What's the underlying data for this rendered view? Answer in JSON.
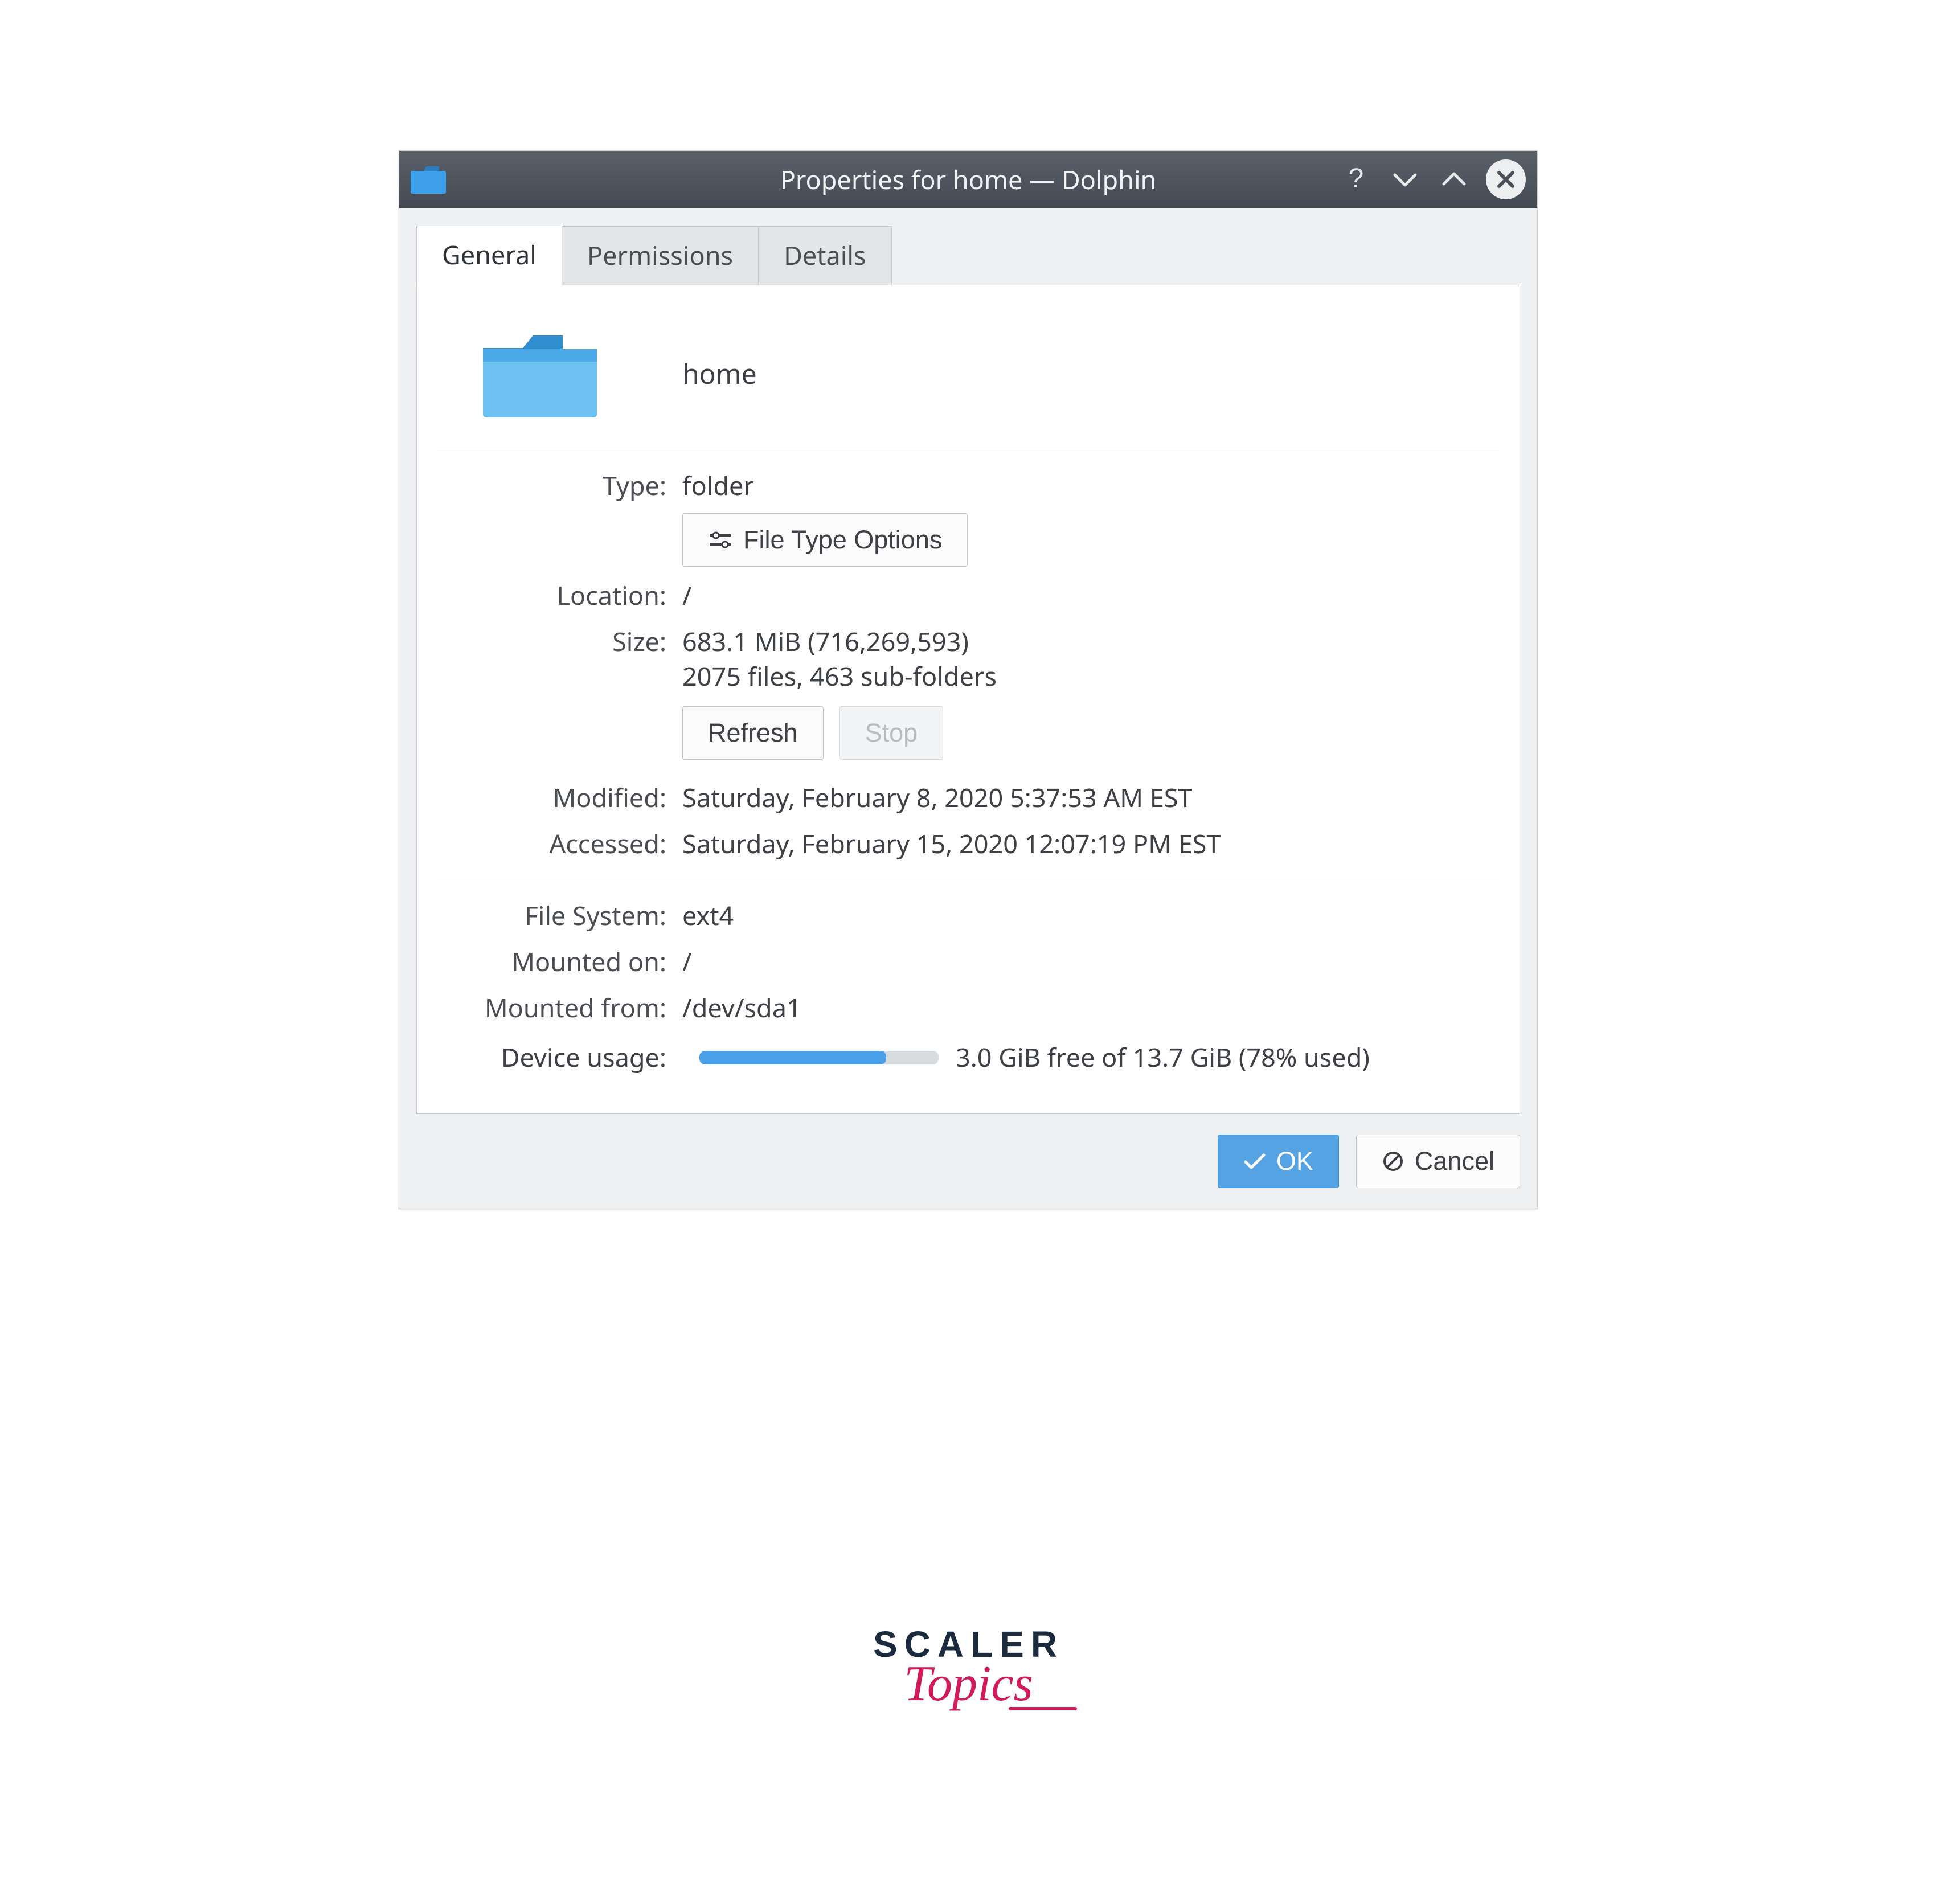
{
  "titlebar": {
    "title": "Properties for home — Dolphin"
  },
  "tabs": [
    {
      "label": "General",
      "active": true
    },
    {
      "label": "Permissions",
      "active": false
    },
    {
      "label": "Details",
      "active": false
    }
  ],
  "general": {
    "folder_name": "home",
    "type_label": "Type:",
    "type_value": "folder",
    "file_type_options_button": "File Type Options",
    "location_label": "Location:",
    "location_value": "/",
    "size_label": "Size:",
    "size_line1": "683.1 MiB (716,269,593)",
    "size_line2": "2075 files, 463 sub-folders",
    "refresh_button": "Refresh",
    "stop_button": "Stop",
    "modified_label": "Modified:",
    "modified_value": "Saturday, February 8, 2020 5:37:53 AM EST",
    "accessed_label": "Accessed:",
    "accessed_value": "Saturday, February 15, 2020 12:07:19 PM EST"
  },
  "fs": {
    "filesystem_label": "File System:",
    "filesystem_value": "ext4",
    "mounted_on_label": "Mounted on:",
    "mounted_on_value": "/",
    "mounted_from_label": "Mounted from:",
    "mounted_from_value": "/dev/sda1",
    "device_usage_label": "Device usage:",
    "device_usage_text": "3.0 GiB free of 13.7 GiB (78% used)",
    "device_usage_percent": 78
  },
  "footer": {
    "ok_label": "OK",
    "cancel_label": "Cancel"
  },
  "brand": {
    "line1": "SCALER",
    "line2": "Topics"
  }
}
